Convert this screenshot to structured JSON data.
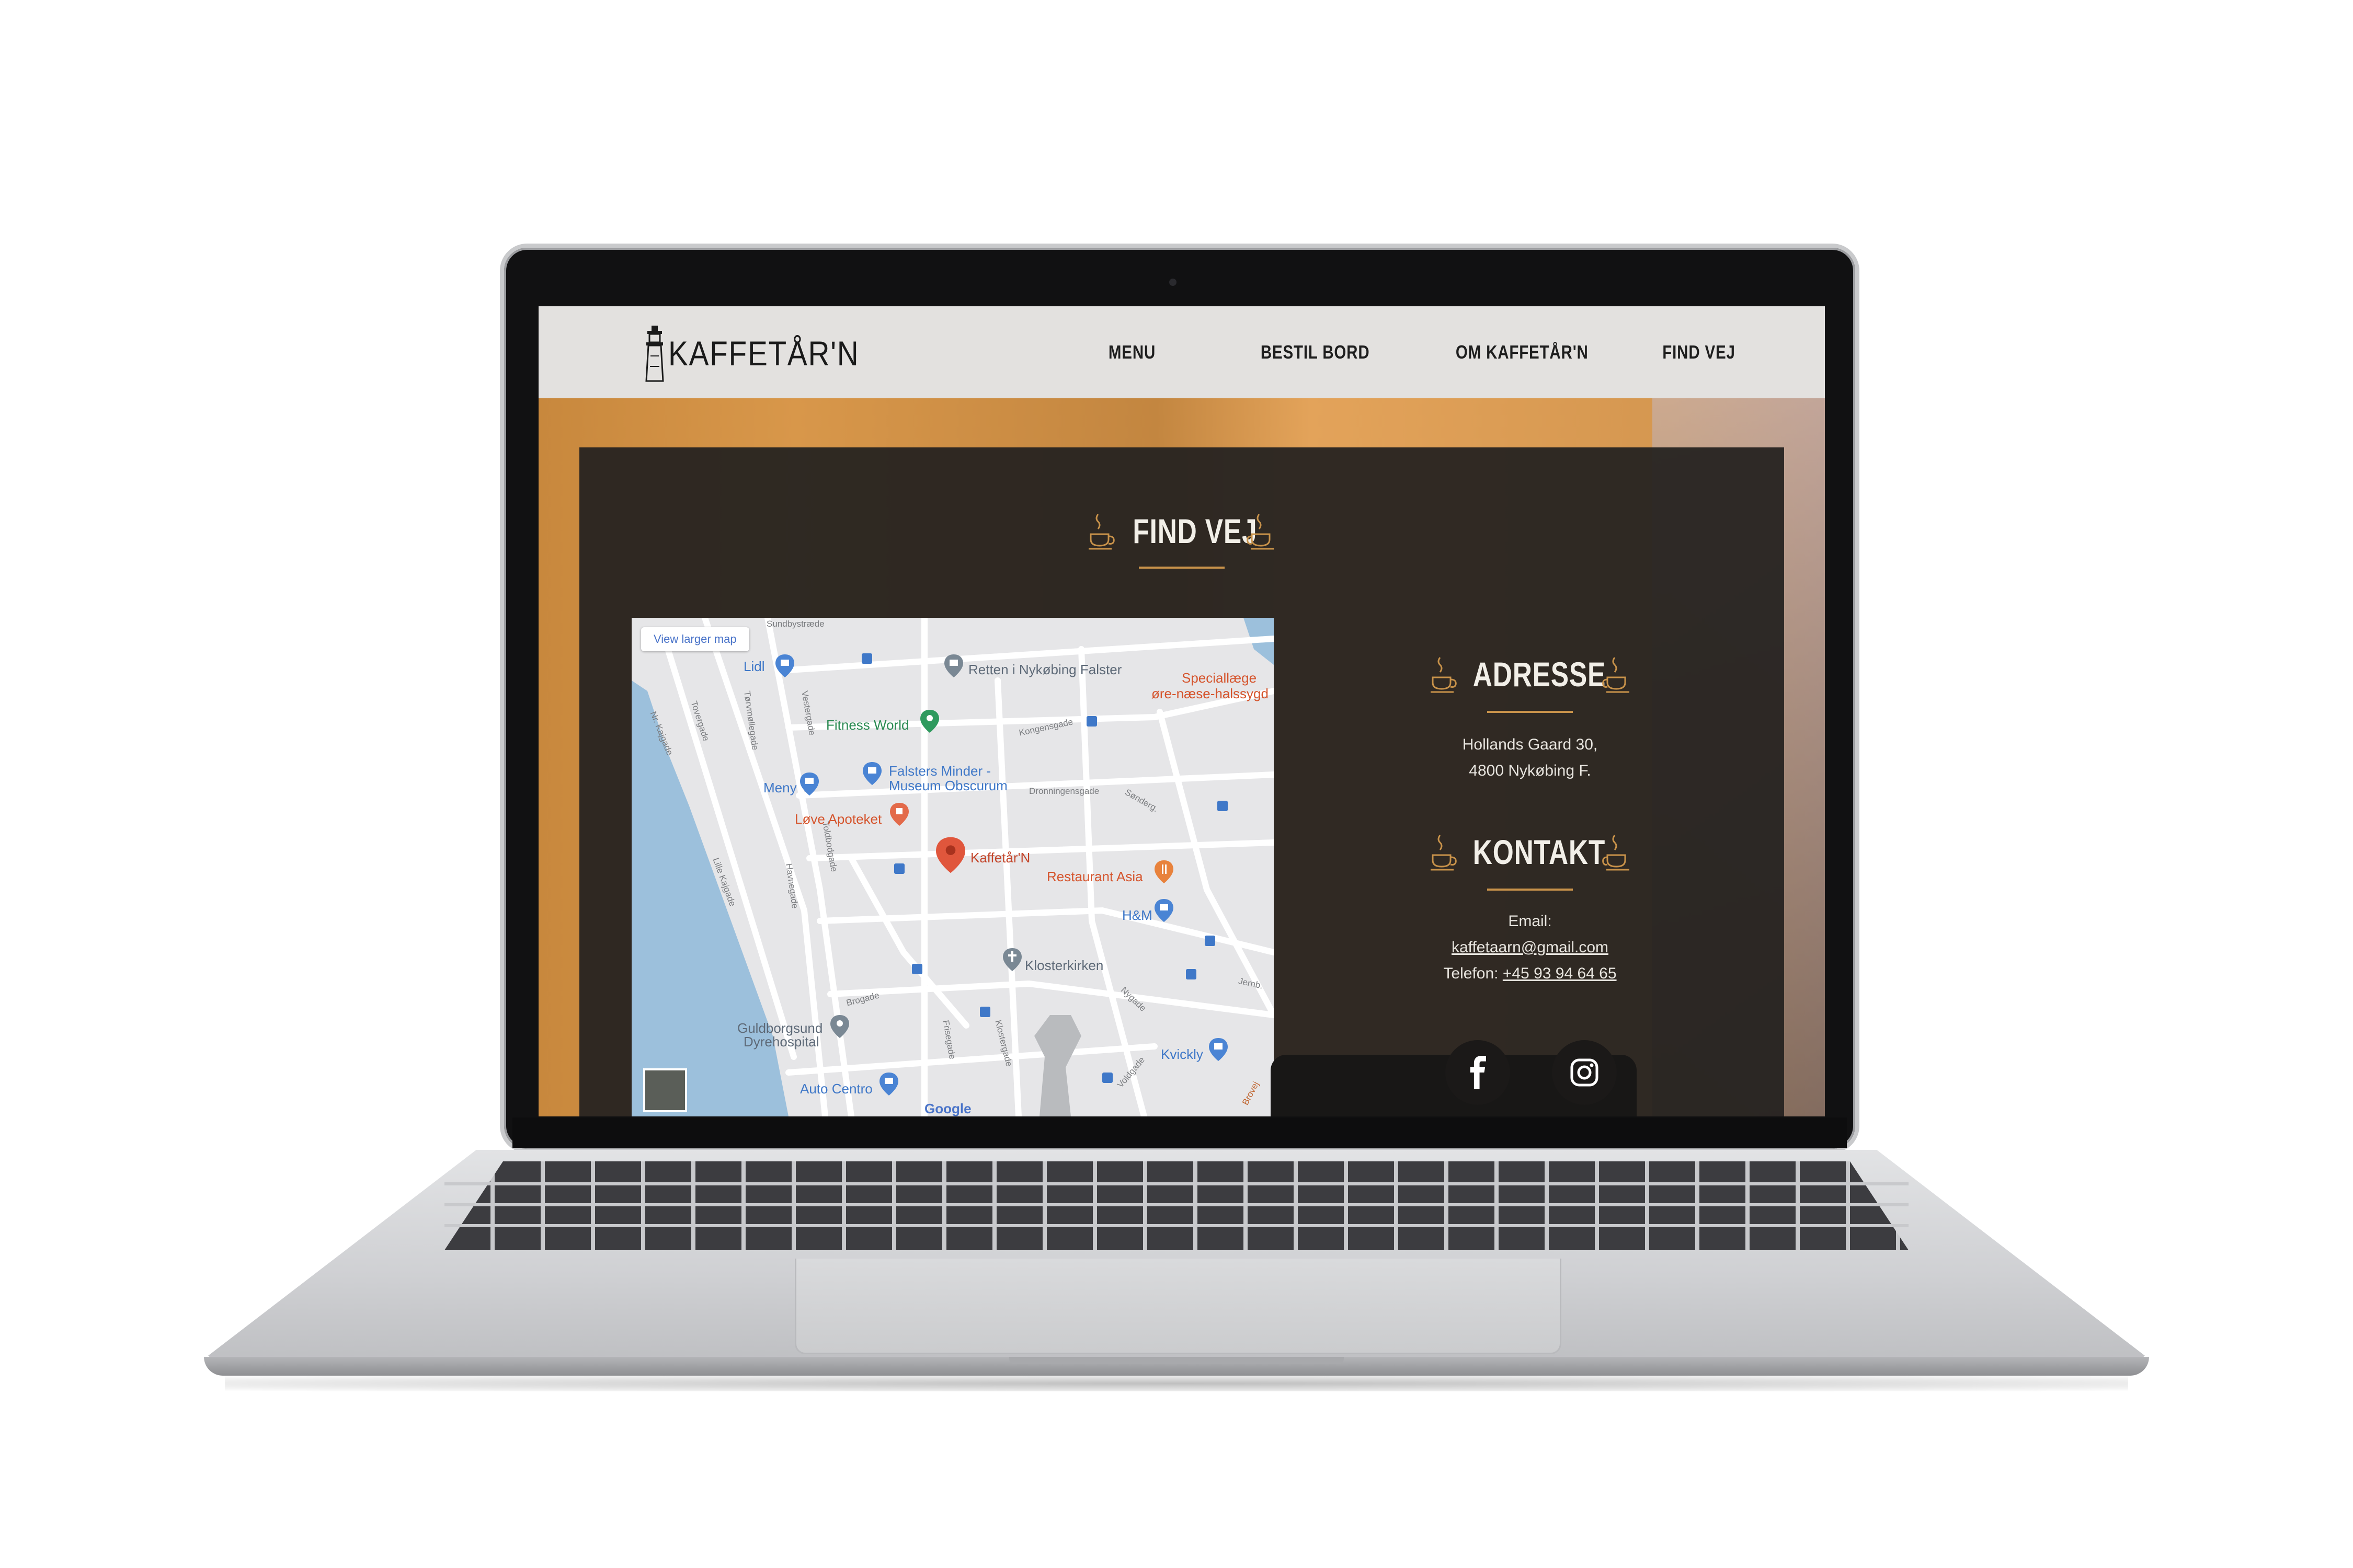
{
  "brand": {
    "name": "KAFFETÅR'N"
  },
  "nav": {
    "items": [
      {
        "label": "MENU"
      },
      {
        "label": "BESTIL BORD"
      },
      {
        "label": "OM KAFFETÅR'N"
      },
      {
        "label": "FIND VEJ"
      }
    ]
  },
  "main": {
    "title": "FIND VEJ"
  },
  "map": {
    "view_larger": "View larger map",
    "places": {
      "lidl": "Lidl",
      "retten": "Retten i Nykøbing Falster",
      "special": "Speciallæge",
      "special2": "øre-næse-halssygd",
      "fitness": "Fitness World",
      "falsters1": "Falsters Minder -",
      "falsters2": "Museum Obscurum",
      "meny": "Meny",
      "loeve": "Løve Apoteket",
      "kaffetaarn": "Kaffetår'N",
      "restaurant": "Restaurant Asia",
      "hm": "H&M",
      "kloster": "Klosterkirken",
      "guldborg1": "Guldborgsund",
      "guldborg2": "Dyrehospital",
      "kvickly": "Kvickly",
      "auto": "Auto Centro",
      "google": "Google"
    },
    "streets": {
      "sundby": "Sundbystræde",
      "vester": "Vestergade",
      "nk": "Nr. Kajgade",
      "tover": "Tovergade",
      "torvm": "Tørvmøllegade",
      "konge": "Kongensgade",
      "dronning": "Dronningensgade",
      "saender": "Sønderg.",
      "lille": "Lille Kajgade",
      "torv": "Toldbodgade",
      "havn": "Havnegade",
      "bro": "Brogade",
      "frisegade": "Frisegade",
      "klostergade": "Klostergade",
      "nygade": "Nygade",
      "volde": "Voldgade",
      "bro2": "Brovej",
      "jernbane": "Jernb."
    }
  },
  "address": {
    "title": "ADRESSE",
    "line1": "Hollands Gaard 30,",
    "line2": "4800 Nykøbing F."
  },
  "contact": {
    "title": "KONTAKT",
    "email_label": "Email:",
    "email": "kaffetaarn@gmail.com",
    "phone_label": "Telefon:",
    "phone": "+45 93 94 64 65"
  },
  "social": [
    "facebook-icon",
    "instagram-icon"
  ],
  "colors": {
    "accent": "#c8924a",
    "panel": "#262321",
    "nav_bg": "#e3e1df",
    "map_water": "#9cc0dc",
    "pin_red": "#e0563c"
  }
}
